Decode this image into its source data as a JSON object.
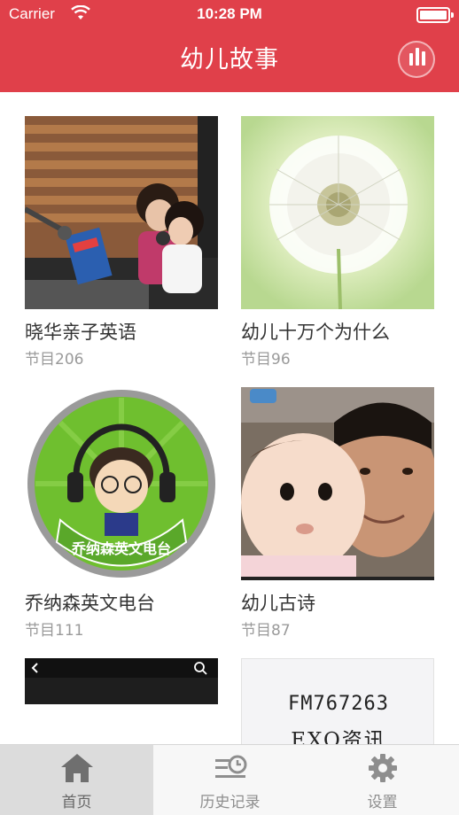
{
  "status_bar": {
    "carrier": "Carrier",
    "time": "10:28 PM"
  },
  "header": {
    "title": "幼儿故事"
  },
  "albums": [
    {
      "title": "晓华亲子英语",
      "count": "节目206"
    },
    {
      "title": "幼儿十万个为什么",
      "count": "节目96"
    },
    {
      "title": "乔纳森英文电台",
      "count": "节目111",
      "badge_text": "乔纳森英文电台"
    },
    {
      "title": "幼儿古诗",
      "count": "节目87"
    },
    {
      "title": "",
      "count": ""
    },
    {
      "title": "",
      "count": "",
      "image_text_1": "FM767263",
      "image_text_2": "EXO资讯"
    }
  ],
  "tabbar": {
    "tabs": [
      {
        "label": "首页",
        "icon": "home-icon",
        "active": true
      },
      {
        "label": "历史记录",
        "icon": "history-icon",
        "active": false
      },
      {
        "label": "设置",
        "icon": "gear-icon",
        "active": false
      }
    ]
  },
  "colors": {
    "accent": "#e0404a",
    "tab_active_bg": "#dcdcdc"
  }
}
